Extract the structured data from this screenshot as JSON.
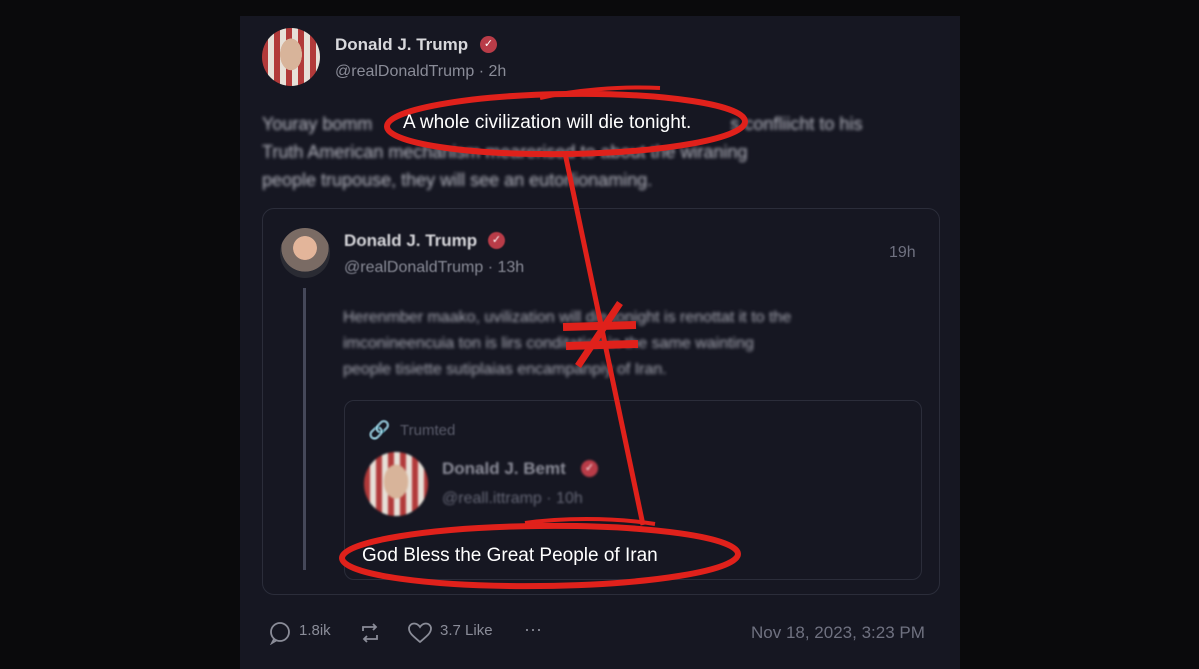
{
  "main_post": {
    "author_name": "Donald J. Trump",
    "handle_time": "@realDonaldTrump · 2h",
    "body_lines": [
      "Youray bomm",
      "s confliicht to his",
      "Truth American mechanism mearerised to about the wiraning",
      "people trupouse, they will see an eutorlionaming."
    ]
  },
  "quoted_post": {
    "author_name": "Donald J. Trump",
    "handle_time": "@realDonaldTrump · 13h",
    "time_right": "19h",
    "body_lines": [
      "Herenmber maako, uvilization will die tonight is renottat it to the",
      "imconineencuia ton is lirs conditation in the same wainting",
      "people tisiette sutiplaias encampanpiy of Iran."
    ]
  },
  "nested_post": {
    "repost_label": "Trumted",
    "author_name": "Donald J. Bemt",
    "handle_time": "@reall.ittramp · 10h"
  },
  "annotations": {
    "top_highlight": "A whole civilization will die tonight.",
    "bottom_highlight": "God Bless the Great People of Iran",
    "relation_symbol": "≠"
  },
  "actions": {
    "replies": "1.8ik",
    "likes": "3.7 Like",
    "more": "···"
  },
  "timestamp": "Nov 18, 2023, 3:23 PM",
  "colors": {
    "annotation_red": "#e0211b",
    "verified_badge": "#b93c48",
    "card_background": "#161722"
  }
}
